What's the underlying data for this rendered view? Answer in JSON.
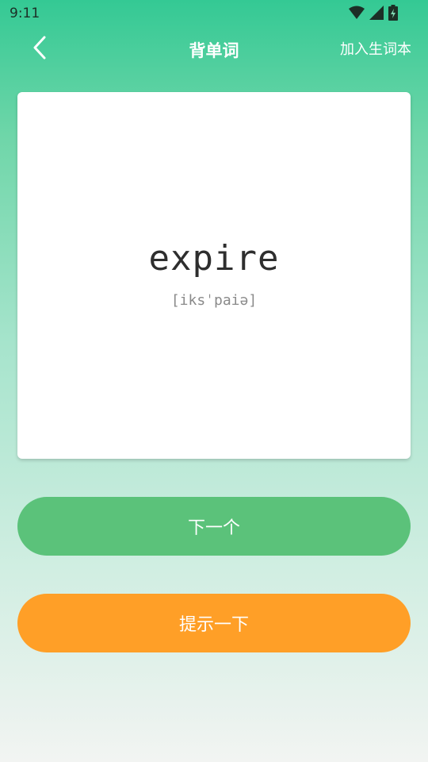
{
  "status": {
    "time": "9:11",
    "icons": [
      "wifi-icon",
      "signal-icon",
      "battery-icon"
    ]
  },
  "header": {
    "title": "背单词",
    "add_label": "加入生词本",
    "back_icon": "chevron-left-icon"
  },
  "card": {
    "word": "expire",
    "phonetic": "[iksˈpaiə]"
  },
  "buttons": {
    "next_label": "下一个",
    "hint_label": "提示一下"
  },
  "colors": {
    "primary_green": "#34c994",
    "next_button": "#5bc27a",
    "hint_button": "#ff9f27",
    "card_background": "#ffffff"
  }
}
